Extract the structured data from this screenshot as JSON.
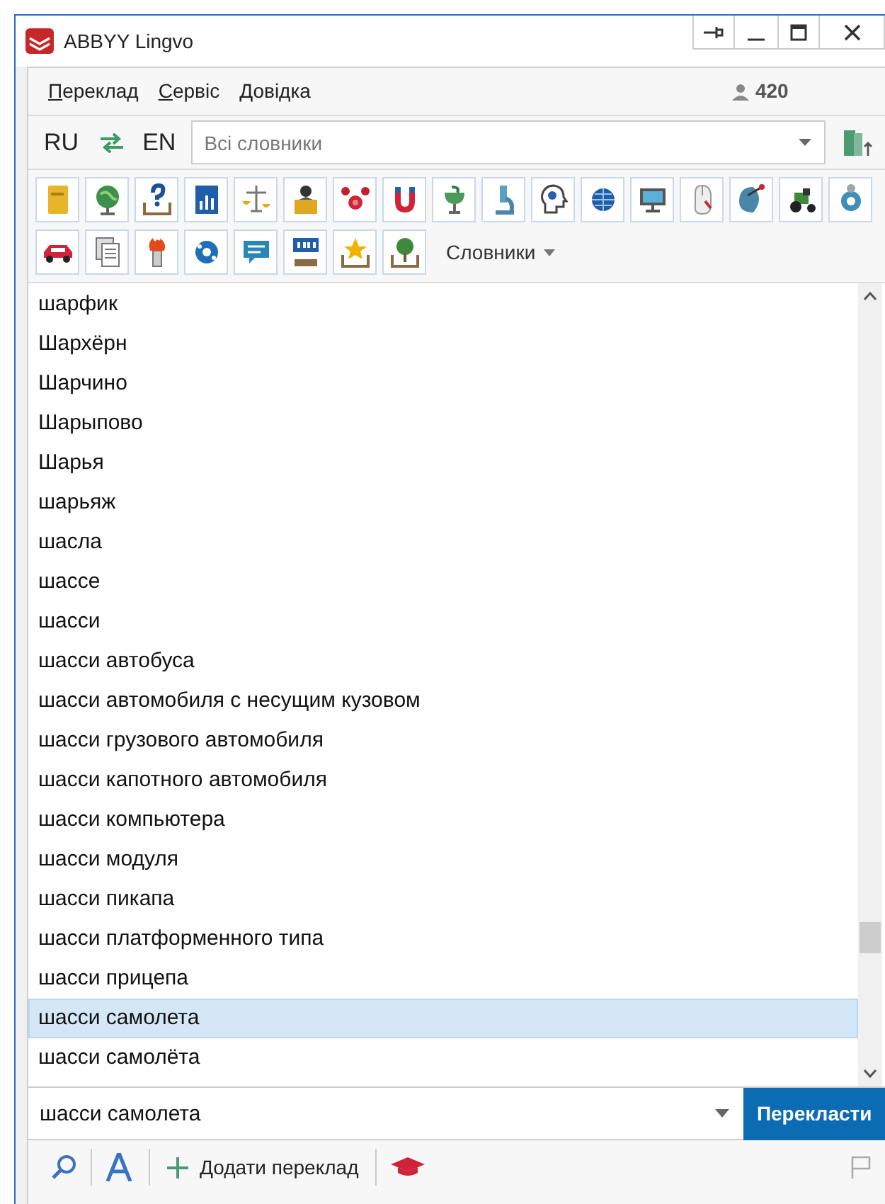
{
  "window": {
    "title": "ABBYY Lingvo"
  },
  "menu": [
    {
      "label": "Переклад"
    },
    {
      "label": "Сервіс"
    },
    {
      "label": "Довідка"
    }
  ],
  "user_count": "420",
  "languages": {
    "source": "RU",
    "target": "EN"
  },
  "dictionary_field": {
    "placeholder": "Всі словники"
  },
  "dictionaries_menu": "Словники",
  "words": [
    {
      "text": "шарфик",
      "selected": false
    },
    {
      "text": "Шархёрн",
      "selected": false
    },
    {
      "text": "Шарчино",
      "selected": false
    },
    {
      "text": "Шарыпово",
      "selected": false
    },
    {
      "text": "Шарья",
      "selected": false
    },
    {
      "text": "шарьяж",
      "selected": false
    },
    {
      "text": "шасла",
      "selected": false
    },
    {
      "text": "шассе",
      "selected": false
    },
    {
      "text": "шасси",
      "selected": false
    },
    {
      "text": "шасси автобуса",
      "selected": false
    },
    {
      "text": "шасси автомобиля с несущим кузовом",
      "selected": false
    },
    {
      "text": "шасси грузового автомобиля",
      "selected": false
    },
    {
      "text": "шасси капотного автомобиля",
      "selected": false
    },
    {
      "text": "шасси компьютера",
      "selected": false
    },
    {
      "text": "шасси модуля",
      "selected": false
    },
    {
      "text": "шасси пикапа",
      "selected": false
    },
    {
      "text": "шасси платформенного типа",
      "selected": false
    },
    {
      "text": "шасси прицепа",
      "selected": false
    },
    {
      "text": "шасси самолета",
      "selected": true
    },
    {
      "text": "шасси самолёта",
      "selected": false
    }
  ],
  "query": {
    "value": "шасси самолета"
  },
  "translate_button": "Перекласти",
  "add_translation": "Додати переклад"
}
